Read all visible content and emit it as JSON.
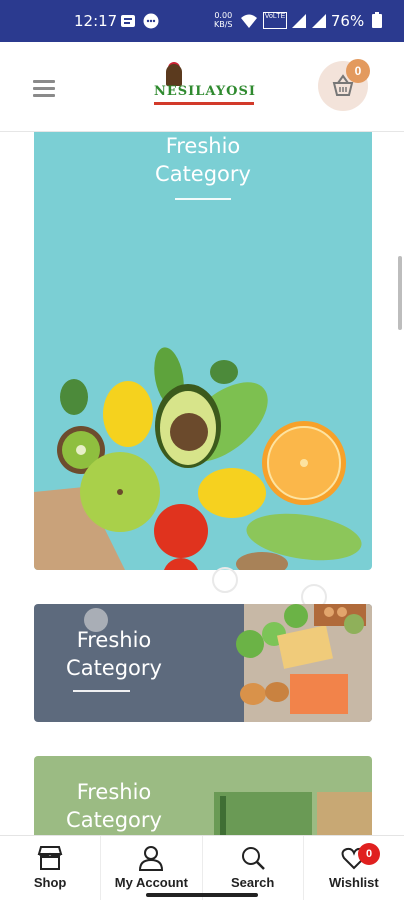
{
  "status_bar": {
    "time": "12:17",
    "battery": "76%",
    "data_speed_top": "0.00",
    "data_speed_bottom": "KB/S",
    "network": "VoLTE"
  },
  "header": {
    "logo_text": "NESILAYOSI",
    "cart_count": "0"
  },
  "categories": [
    {
      "title_line1": "Freshio",
      "title_line2": "Category"
    },
    {
      "title_line1": "Freshio",
      "title_line2": "Category"
    },
    {
      "title_line1": "Freshio",
      "title_line2": "Category"
    }
  ],
  "tabs": [
    {
      "label": "Shop",
      "icon": "shop-icon"
    },
    {
      "label": "My Account",
      "icon": "user-icon"
    },
    {
      "label": "Search",
      "icon": "search-icon"
    },
    {
      "label": "Wishlist",
      "icon": "heart-icon"
    }
  ],
  "wishlist_count": "0",
  "colors": {
    "status_bar": "#2b3a8f",
    "hero_bg": "#7bcfd4",
    "card2_bg": "#5d6a7d",
    "card3_bg": "#9bbb83",
    "cart_badge": "#e39a5e",
    "wish_badge": "#e0201f"
  }
}
